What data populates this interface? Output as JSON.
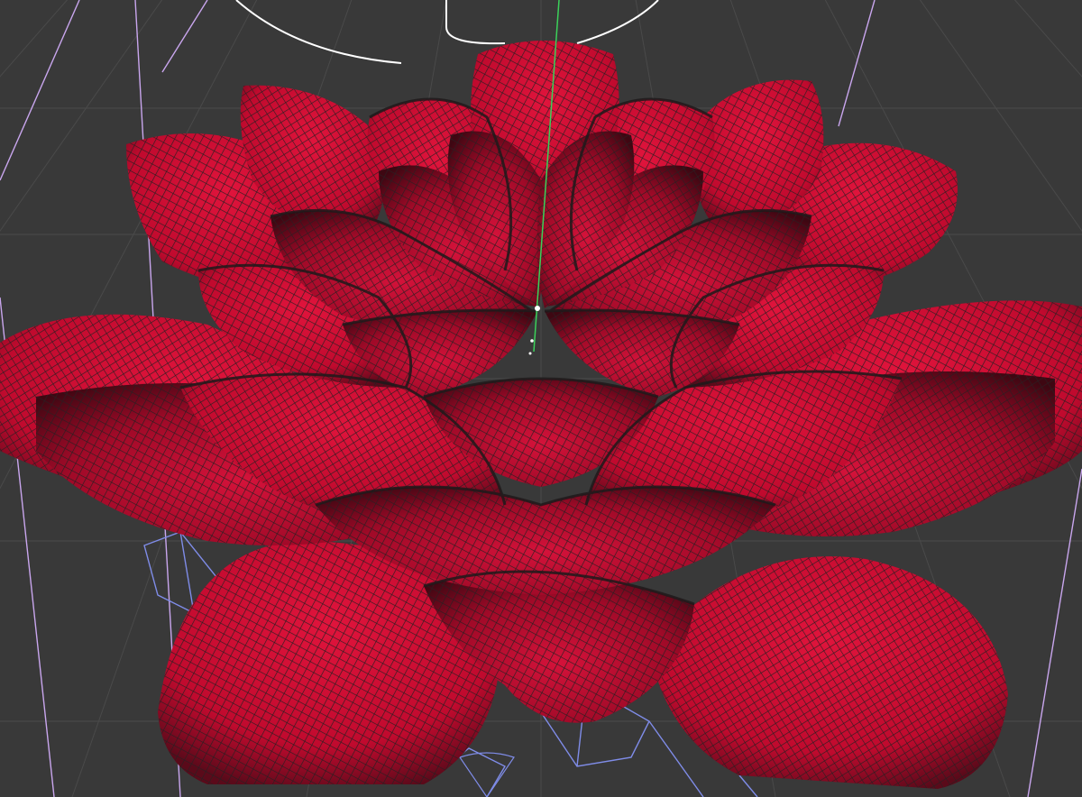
{
  "viewport": {
    "background_color": "#393939",
    "grid_line_color": "#4a4a4a",
    "selection_wire_color": "#ffffff",
    "camera_wire_color": "#c9a6ee",
    "bone_wire_color": "#7f8ce8",
    "axis_y_color": "#3bd15a",
    "mesh": {
      "object": "lotus-flower",
      "display": "wireframe-on-shaded",
      "surface_color": "#c00a2e",
      "surface_highlight": "#e0143c",
      "surface_shadow": "#5a0a1a",
      "wire_color": "#2a1f22",
      "petal_layers": 5
    }
  }
}
